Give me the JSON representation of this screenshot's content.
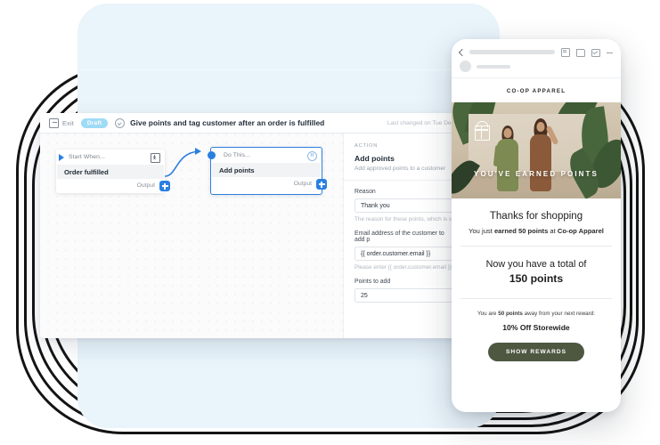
{
  "app": {
    "header": {
      "exit_label": "Exit",
      "status_badge": "Draft",
      "flow_title": "Give points and tag customer after an order is fulfilled",
      "last_changed": "Last changed on Tue Dec"
    },
    "canvas": {
      "nodes": [
        {
          "top_label": "Start When...",
          "main_label": "Order fulfilled",
          "output_label": "Output",
          "corner_icon": "download-icon"
        },
        {
          "top_label": "Do This...",
          "main_label": "Add points",
          "output_label": "Output",
          "corner_icon": "help-circle-icon"
        }
      ]
    },
    "side_panel": {
      "eyebrow": "ACTION",
      "title": "Add points",
      "subtitle": "Add approved points to a customer",
      "fields": [
        {
          "label": "Reason",
          "value": "Thank you",
          "help": "The reason for these points, which is s"
        },
        {
          "label": "Email address of the customer to add p",
          "value": "{{ order.customer.email }}",
          "help": "Please enter {{ order.customer.email }}"
        },
        {
          "label": "Points to add",
          "value": "25",
          "help": ""
        }
      ]
    }
  },
  "phone": {
    "toolbar": {
      "icons": [
        "back-chevron-icon",
        "archive-icon",
        "trash-icon",
        "mail-icon",
        "more-icon"
      ]
    },
    "email": {
      "brand": "CO-OP APPAREL",
      "hero_caption": "YOU'VE EARNED POINTS",
      "heading": "Thanks for shopping",
      "earned_prefix": "You just ",
      "earned_bold": "earned 50 points",
      "earned_middle": " at ",
      "earned_brand": "Co-op Apparel",
      "total_label": "Now you have a total of",
      "total_value": "150 points",
      "away_prefix": "You are ",
      "away_bold": "50 points",
      "away_suffix": " away from your next reward:",
      "reward_name": "10% Off Storewide",
      "cta_label": "SHOW REWARDS"
    }
  },
  "colors": {
    "accent_blue": "#2b7fe0",
    "draft_badge": "#9fdbf5",
    "panel_blue": "#e9f4fb",
    "cta_green": "#4e5740"
  }
}
